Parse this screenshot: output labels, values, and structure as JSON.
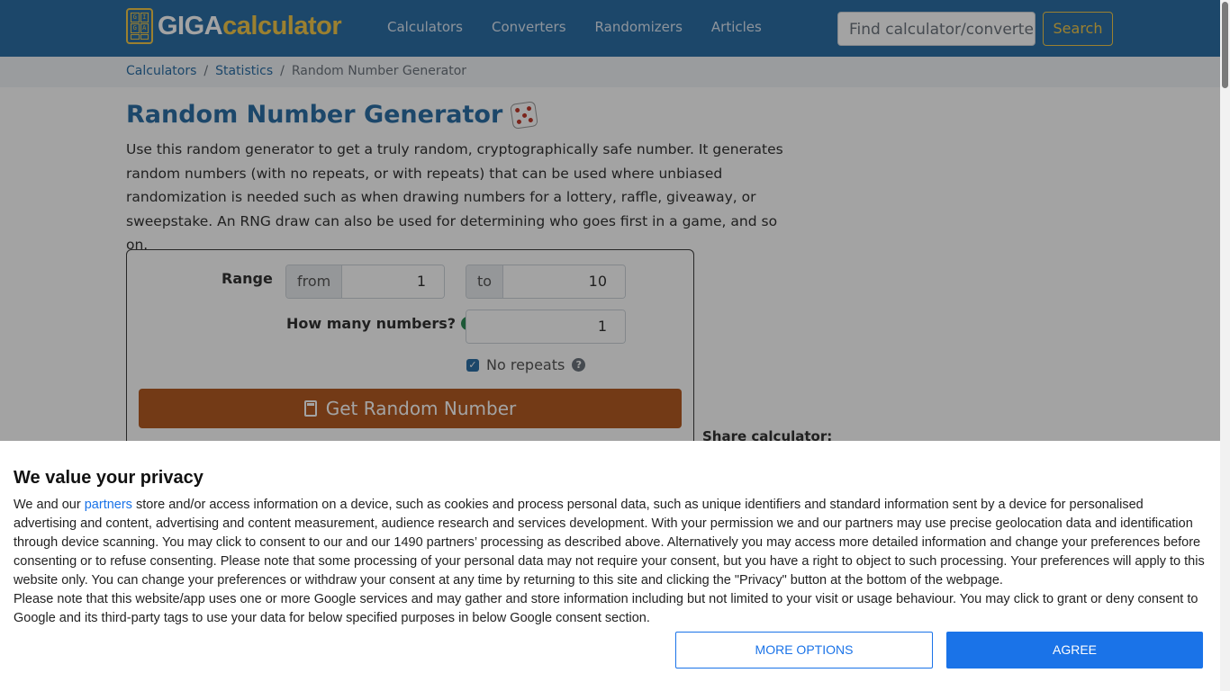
{
  "header": {
    "logo_part1": "GIGA",
    "logo_part2": "calculator",
    "logo_box_letters": [
      "G",
      "I",
      "G",
      "A",
      "",
      ""
    ],
    "nav": [
      "Calculators",
      "Converters",
      "Randomizers",
      "Articles"
    ],
    "search_placeholder": "Find calculator/converter",
    "search_button": "Search"
  },
  "breadcrumb": {
    "items": [
      "Calculators",
      "Statistics"
    ],
    "current": "Random Number Generator",
    "separator": "/"
  },
  "main": {
    "title": "Random Number Generator",
    "description": "Use this random generator to get a truly random, cryptographically safe number. It generates random numbers (with no repeats, or with repeats) that can be used where unbiased randomization is needed such as when drawing numbers for a lottery, raffle, giveaway, or sweepstake. An RNG draw can also be used for determining who goes first in a game, and so on."
  },
  "calculator": {
    "range_label": "Range",
    "from_prefix": "from",
    "from_value": "1",
    "to_prefix": "to",
    "to_value": "10",
    "how_many_label": "How many numbers?",
    "how_many_value": "1",
    "no_repeats_label": "No repeats",
    "no_repeats_checked": true,
    "help_glyph": "?",
    "check_glyph": "✓",
    "submit_label": "Get Random Number",
    "share_label": "Share calculator:"
  },
  "consent": {
    "title": "We value your privacy",
    "p1_before": "We and our ",
    "p1_link": "partners",
    "p1_after": " store and/or access information on a device, such as cookies and process personal data, such as unique identifiers and standard information sent by a device for personalised advertising and content, advertising and content measurement, audience research and services development. With your permission we and our partners may use precise geolocation data and identification through device scanning. You may click to consent to our and our 1490 partners’ processing as described above. Alternatively you may access more detailed information and change your preferences before consenting or to refuse consenting. Please note that some processing of your personal data may not require your consent, but you have a right to object to such processing. Your preferences will apply to this website only. You can change your preferences or withdraw your consent at any time by returning to this site and clicking the \"Privacy\" button at the bottom of the webpage.",
    "p2": "Please note that this website/app uses one or more Google services and may gather and store information including but not limited to your visit or usage behaviour. You may click to grant or deny consent to Google and its third-party tags to use your data for below specified purposes in below Google consent section.",
    "more_options": "MORE OPTIONS",
    "agree": "AGREE"
  },
  "colors": {
    "navbar": "#2c6fa6",
    "accent_yellow": "#f2c94c",
    "submit_button": "#b55c23",
    "consent_blue": "#1a73e8"
  }
}
